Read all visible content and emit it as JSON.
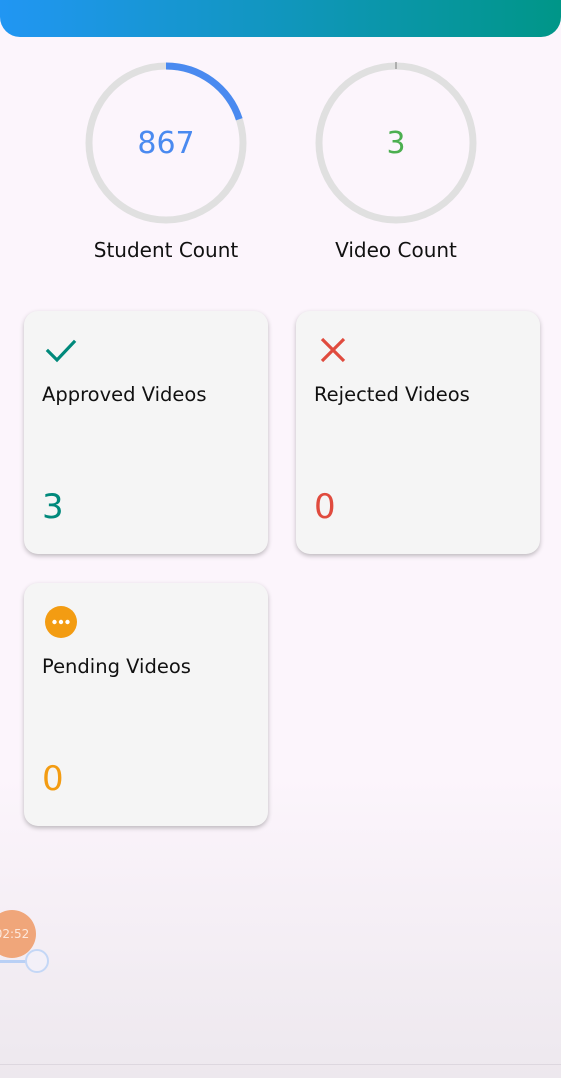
{
  "header": {
    "gradient_start": "#2196f3",
    "gradient_end": "#009688"
  },
  "stats": {
    "student": {
      "value": "867",
      "label": "Student Count",
      "progress": 0.2,
      "color": "#4a8af0"
    },
    "video": {
      "value": "3",
      "label": "Video Count",
      "progress": 0.003,
      "color": "#4caf50"
    }
  },
  "cards": {
    "approved": {
      "icon": "check-icon",
      "title": "Approved Videos",
      "count": "3",
      "color": "#00897b"
    },
    "rejected": {
      "icon": "close-icon",
      "title": "Rejected Videos",
      "count": "0",
      "color": "#e04b3e"
    },
    "pending": {
      "icon": "more-horizontal-icon",
      "title": "Pending Videos",
      "count": "0",
      "color": "#f39c12"
    }
  },
  "recorder": {
    "time": "02:52"
  }
}
